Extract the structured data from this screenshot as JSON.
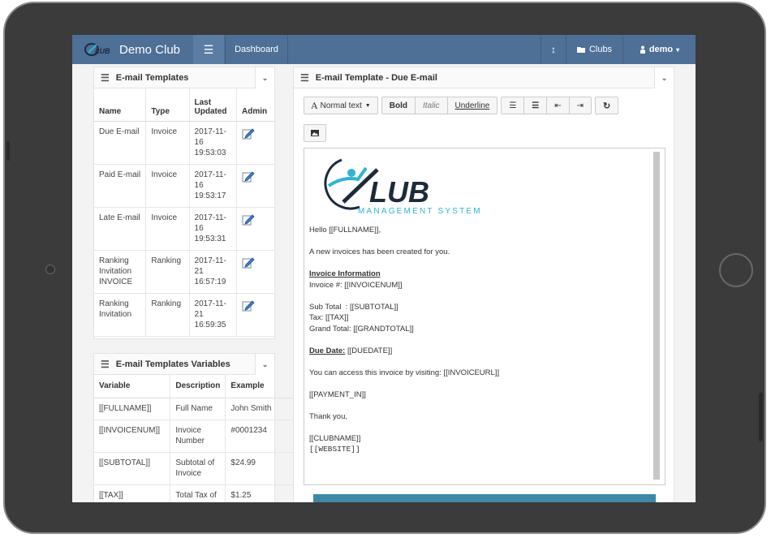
{
  "navbar": {
    "brand": "Demo Club",
    "dashboard": "Dashboard",
    "clubs": "Clubs",
    "user": "demo"
  },
  "templates_panel": {
    "title": "E-mail Templates",
    "headers": [
      "Name",
      "Type",
      "Last Updated",
      "Admin"
    ],
    "rows": [
      {
        "name": "Due E-mail",
        "type": "Invoice",
        "updated": "2017-11-16 19:53:03"
      },
      {
        "name": "Paid E-mail",
        "type": "Invoice",
        "updated": "2017-11-16 19:53:17"
      },
      {
        "name": "Late E-mail",
        "type": "Invoice",
        "updated": "2017-11-16 19:53:31"
      },
      {
        "name": "Ranking Invitation INVOICE",
        "type": "Ranking",
        "updated": "2017-11-21 16:57:19"
      },
      {
        "name": "Ranking Invitation",
        "type": "Ranking",
        "updated": "2017-11-21 16:59:35"
      }
    ]
  },
  "variables_panel": {
    "title": "E-mail Templates Variables",
    "headers": [
      "Variable",
      "Description",
      "Example"
    ],
    "rows": [
      {
        "variable": "[[FULLNAME]]",
        "description": "Full Name",
        "example": "John Smith"
      },
      {
        "variable": "[[INVOICENUM]]",
        "description": "Invoice Number",
        "example": "#0001234"
      },
      {
        "variable": "[[SUBTOTAL]]",
        "description": "Subtotal of Invoice",
        "example": "$24.99"
      },
      {
        "variable": "[[TAX]]",
        "description": "Total Tax of",
        "example": "$1.25"
      }
    ]
  },
  "editor_panel": {
    "title": "E-mail Template - Due E-mail",
    "toolbar": {
      "normal_text": "Normal text",
      "bold": "Bold",
      "italic": "Italic",
      "underline": "Underline"
    },
    "logo": {
      "main": "LUB",
      "sub": "MANAGEMENT SYSTEM"
    },
    "body": {
      "greeting": "Hello [[FULLNAME]],",
      "intro": "A new invoices has been created for you.",
      "info_heading": "Invoice Information",
      "invoice_num": "Invoice #: [[INVOICENUM]]",
      "subtotal": "Sub Total  : [[SUBTOTAL]]",
      "tax": "Tax: [[TAX]]",
      "grand_total": "Grand Total: [[GRANDTOTAL]]",
      "due_label": "Due Date:",
      "due_value": " [[DUEDATE]]",
      "access": "You can access this invoice by visiting: [[INVOICEURL]]",
      "payment": "[[PAYMENT_IN]]",
      "thanks": "Thank you,",
      "club_name": "[[CLUBNAME]]",
      "website": "[[WEBSITE]]"
    }
  },
  "colors": {
    "navbar": "#4e6f96",
    "accent_blue": "#3e88a6",
    "logo_cyan": "#2fb3d6",
    "logo_dark": "#1d2a3a"
  }
}
